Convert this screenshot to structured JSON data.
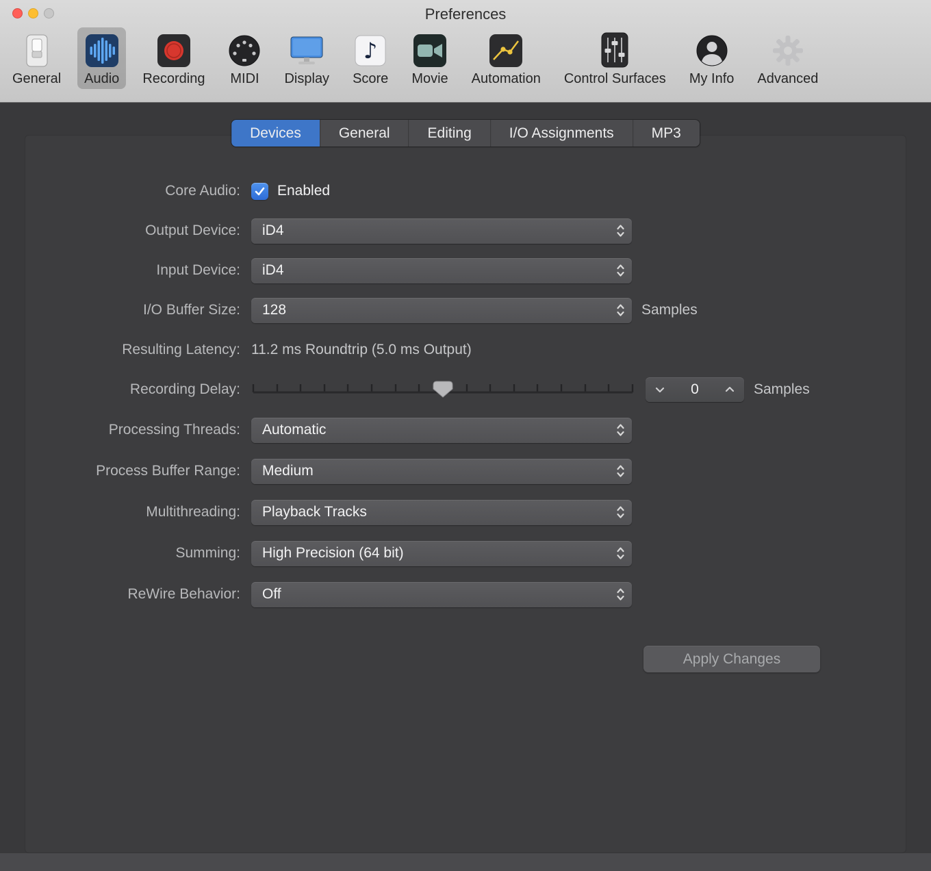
{
  "window": {
    "title": "Preferences"
  },
  "toolbar": {
    "items": [
      {
        "label": "General",
        "icon": "general-icon",
        "selected": false
      },
      {
        "label": "Audio",
        "icon": "audio-icon",
        "selected": true
      },
      {
        "label": "Recording",
        "icon": "recording-icon",
        "selected": false
      },
      {
        "label": "MIDI",
        "icon": "midi-icon",
        "selected": false
      },
      {
        "label": "Display",
        "icon": "display-icon",
        "selected": false
      },
      {
        "label": "Score",
        "icon": "score-icon",
        "selected": false
      },
      {
        "label": "Movie",
        "icon": "movie-icon",
        "selected": false
      },
      {
        "label": "Automation",
        "icon": "automation-icon",
        "selected": false
      },
      {
        "label": "Control Surfaces",
        "icon": "control-surfaces-icon",
        "selected": false
      },
      {
        "label": "My Info",
        "icon": "my-info-icon",
        "selected": false
      },
      {
        "label": "Advanced",
        "icon": "advanced-icon",
        "selected": false
      }
    ]
  },
  "tabs": [
    {
      "label": "Devices",
      "selected": true
    },
    {
      "label": "General",
      "selected": false
    },
    {
      "label": "Editing",
      "selected": false
    },
    {
      "label": "I/O Assignments",
      "selected": false
    },
    {
      "label": "MP3",
      "selected": false
    }
  ],
  "form": {
    "core_audio": {
      "label": "Core Audio:",
      "checkbox_label": "Enabled",
      "checked": true
    },
    "output_device": {
      "label": "Output Device:",
      "value": "iD4"
    },
    "input_device": {
      "label": "Input Device:",
      "value": "iD4"
    },
    "io_buffer_size": {
      "label": "I/O Buffer Size:",
      "value": "128",
      "suffix": "Samples"
    },
    "resulting_latency": {
      "label": "Resulting Latency:",
      "value": "11.2 ms Roundtrip (5.0 ms Output)"
    },
    "recording_delay": {
      "label": "Recording Delay:",
      "value": "0",
      "suffix": "Samples"
    },
    "processing_threads": {
      "label": "Processing Threads:",
      "value": "Automatic"
    },
    "process_buffer_range": {
      "label": "Process Buffer Range:",
      "value": "Medium"
    },
    "multithreading": {
      "label": "Multithreading:",
      "value": "Playback Tracks"
    },
    "summing": {
      "label": "Summing:",
      "value": "High Precision (64 bit)"
    },
    "rewire_behavior": {
      "label": "ReWire Behavior:",
      "value": "Off"
    },
    "apply_button": "Apply Changes"
  },
  "colors": {
    "tab_selected_blue": "#3e76c8",
    "checkbox_blue": "#3a7de0",
    "record_red": "#d7372e",
    "automation_yellow": "#edc53f",
    "header_gray": "#d0d0d0",
    "content_dark": "#39393b"
  }
}
